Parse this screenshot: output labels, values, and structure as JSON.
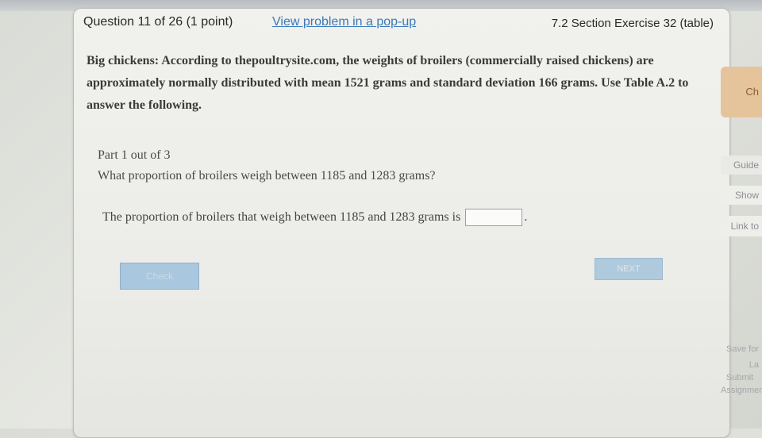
{
  "header": {
    "question_number": "Question 11 of 26 (1 point)",
    "popup_link": "View problem in a pop-up",
    "section": "7.2 Section Exercise 32 (table)"
  },
  "problem": {
    "text": "Big chickens: According to thepoultrysite.com, the weights of broilers (commercially raised chickens) are approximately normally distributed with mean 1521 grams and standard deviation 166 grams. Use Table A.2 to answer the following."
  },
  "part": {
    "label": "Part 1 out of 3",
    "question": "What proportion of broilers weigh between 1185 and 1283 grams?",
    "answer_prompt": "The proportion of broilers that weigh between 1185 and 1283 grams is",
    "answer_value": "",
    "answer_suffix": "."
  },
  "buttons": {
    "check": "Check",
    "next": "NEXT"
  },
  "side_panel": {
    "check": "Ch",
    "guided": "Guide",
    "show": "Show",
    "link": "Link to",
    "save": "Save for La",
    "submit": "Submit Assignmen"
  },
  "colors": {
    "link": "#3a7ab8",
    "side_check": "#e6c49b",
    "button_blue": "#a9c7de"
  }
}
